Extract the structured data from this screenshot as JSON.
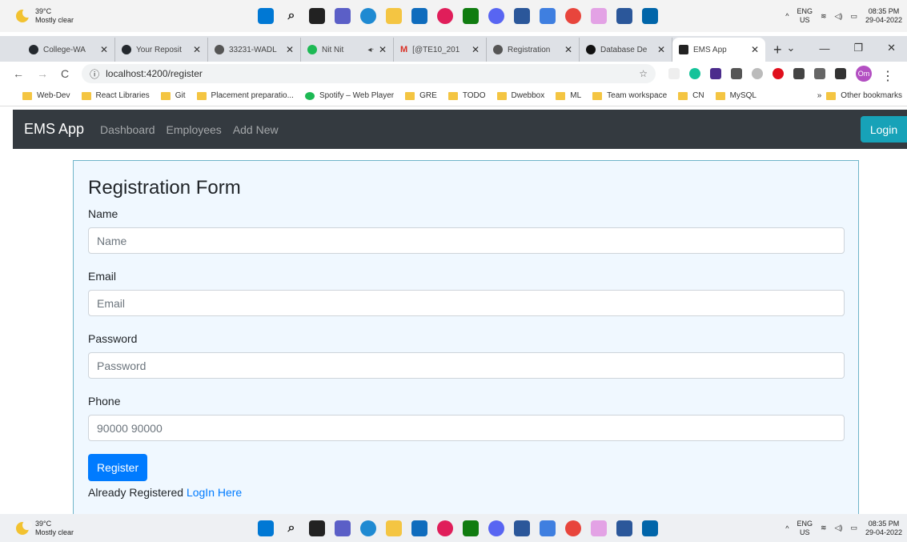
{
  "taskbar": {
    "temperature": "39°C",
    "condition": "Mostly clear",
    "lang_top": "ENG",
    "lang_bottom": "US",
    "time": "08:35 PM",
    "date": "29-04-2022"
  },
  "taskbar_bottom_time": "08:35 PM",
  "tabs": [
    {
      "title": "College-WA",
      "color": "#24292e"
    },
    {
      "title": "Your Reposit",
      "color": "#24292e"
    },
    {
      "title": "33231-WADL",
      "color": "#555555"
    },
    {
      "title": "Nit Nit",
      "color": "#1db954"
    },
    {
      "title": "[@TE10_201",
      "color": "#d93025"
    },
    {
      "title": "Registration",
      "color": "#555555"
    },
    {
      "title": "Database De",
      "color": "#111111"
    },
    {
      "title": "EMS App",
      "color": "#222222"
    }
  ],
  "address": {
    "url": "localhost:4200/register"
  },
  "bookmarks": [
    "Web-Dev",
    "React Libraries",
    "Git",
    "Placement preparatio...",
    "Spotify – Web Player",
    "GRE",
    "TODO",
    "Dwebbox",
    "ML",
    "Team workspace",
    "CN",
    "MySQL"
  ],
  "bookmarks_other": "Other bookmarks",
  "avatar_initials": "Om",
  "nav": {
    "brand": "EMS App",
    "links": [
      "Dashboard",
      "Employees",
      "Add New"
    ],
    "login": "Login"
  },
  "form": {
    "title": "Registration Form",
    "name_label": "Name",
    "name_placeholder": "Name",
    "email_label": "Email",
    "email_placeholder": "Email",
    "password_label": "Password",
    "password_placeholder": "Password",
    "phone_label": "Phone",
    "phone_placeholder": "90000 90000",
    "submit": "Register",
    "already_text": "Already Registered",
    "login_link": "LogIn Here"
  },
  "colors": {
    "navbar": "#343a40",
    "login_button": "#17a2b8",
    "primary": "#007bff",
    "card_bg": "#f0f8ff"
  }
}
